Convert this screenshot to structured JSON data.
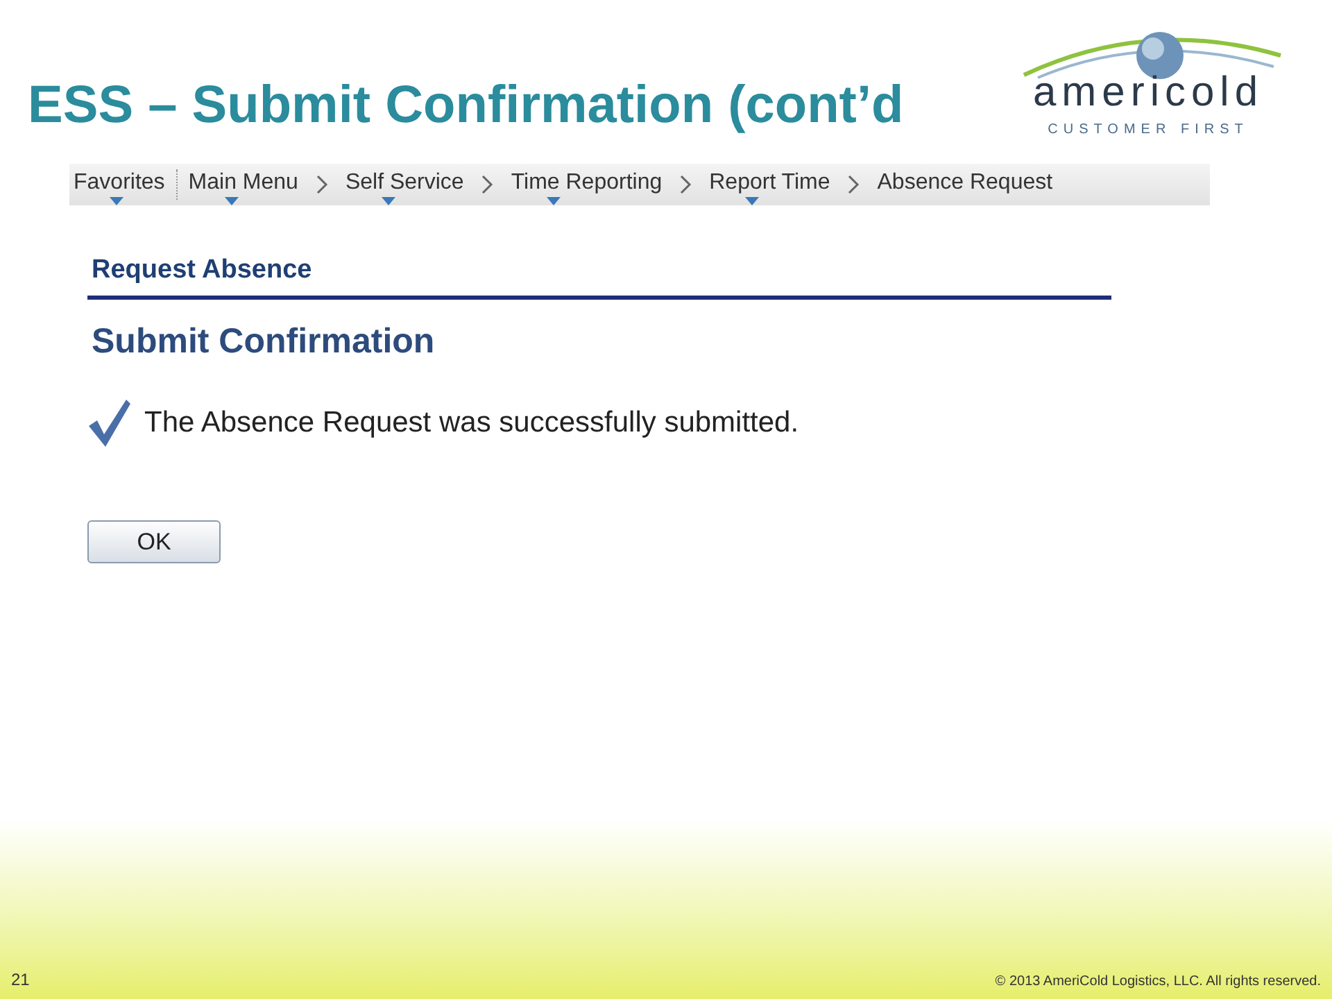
{
  "slide": {
    "title": "ESS – Submit Confirmation (cont’d",
    "page_number": "21",
    "copyright": "© 2013 AmeriCold Logistics, LLC. All rights reserved."
  },
  "logo": {
    "name": "americold",
    "tagline": "CUSTOMER FIRST"
  },
  "breadcrumb": [
    {
      "label": "Favorites",
      "has_menu": true
    },
    {
      "label": "Main Menu",
      "has_menu": true
    },
    {
      "label": "Self Service",
      "has_menu": true
    },
    {
      "label": "Time Reporting",
      "has_menu": true
    },
    {
      "label": "Report Time",
      "has_menu": true
    },
    {
      "label": "Absence Request",
      "has_menu": false
    }
  ],
  "page": {
    "header": "Request Absence",
    "heading": "Submit Confirmation",
    "message": "The Absence Request was successfully submitted.",
    "button": "OK"
  }
}
